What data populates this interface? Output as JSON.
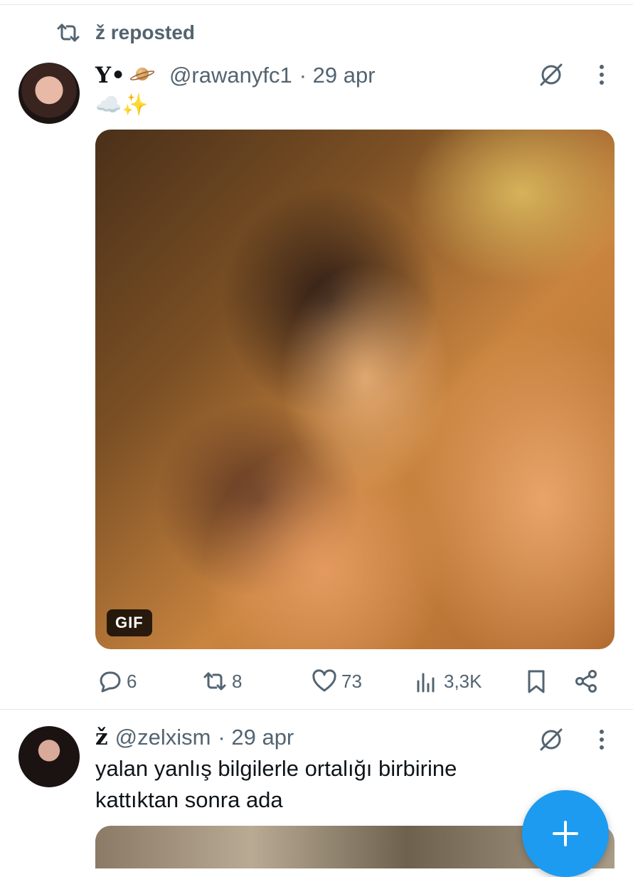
{
  "colors": {
    "accent": "#1d9bf0",
    "secondary_text": "#536471",
    "primary_text": "#0f1419"
  },
  "repost_banner": {
    "icon": "repost-icon",
    "text": "ž reposted"
  },
  "tweet1": {
    "display_name": "Y•",
    "name_emoji": "planet-emoji",
    "handle": "@rawanyfc1",
    "date": "· 29 apr",
    "text": "☁️✨",
    "media_badge": "GIF",
    "actions": {
      "replies": "6",
      "reposts": "8",
      "likes": "73",
      "views": "3,3K"
    }
  },
  "tweet2": {
    "display_name": "ž",
    "handle": "@zelxism",
    "date": "· 29 apr",
    "text": "yalan yanlış bilgilerle ortalığı birbirine kattıktan sonra ada"
  },
  "fab": {
    "icon": "plus-icon"
  }
}
